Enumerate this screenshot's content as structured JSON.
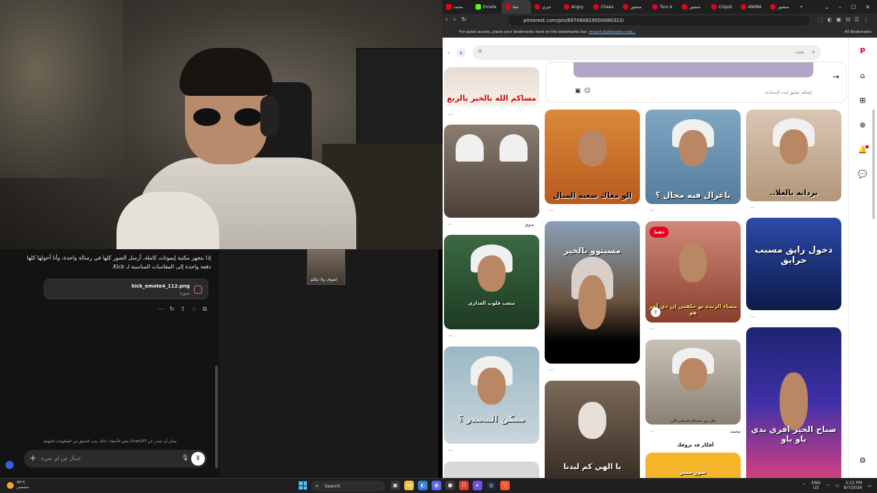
{
  "browser": {
    "tabs": [
      {
        "label": "محمد",
        "icon": "youtube-icon"
      },
      {
        "label": "Emote",
        "icon": "kick-icon"
      },
      {
        "label": "عط",
        "icon": "pinterest-icon",
        "active": true
      },
      {
        "label": "جيري",
        "icon": "pinterest-icon"
      },
      {
        "label": "Angry",
        "icon": "pinterest-icon"
      },
      {
        "label": "Chees",
        "icon": "pinterest-icon"
      },
      {
        "label": "منشور",
        "icon": "pinterest-icon"
      },
      {
        "label": "Tom A",
        "icon": "pinterest-icon"
      },
      {
        "label": "منشور",
        "icon": "pinterest-icon"
      },
      {
        "label": "Chipot",
        "icon": "pinterest-icon"
      },
      {
        "label": "ANIMA",
        "icon": "pinterest-icon"
      },
      {
        "label": "منشور",
        "icon": "pinterest-icon"
      }
    ],
    "url": "pinterest.com/pin/897060819500080322/",
    "bookmarks_prompt": "For quick access, place your bookmarks here on the bookmarks bar.",
    "bookmarks_import": "Import bookmarks now...",
    "all_bookmarks": "All Bookmarks"
  },
  "pinterest": {
    "search_placeholder": "بحث",
    "avatar_letter": "ع",
    "comment_placeholder": "إضافة تعليق لبدء المحادثة",
    "save_label": "حفظ",
    "ideas_label": "أفكار قد تروقك",
    "pins": [
      {
        "caption": "مساكم الله بالخير يالربع",
        "under": ""
      },
      {
        "caption": "",
        "under": "بدوي"
      },
      {
        "caption": "الو معاك صعبة المنال",
        "under": ""
      },
      {
        "caption": "ياغزال فيه مجال ؟",
        "under": ""
      },
      {
        "caption": "بردانه يالغلا..",
        "under": ""
      },
      {
        "caption": "متعب قلوب العذارى",
        "under": ""
      },
      {
        "caption": "مسيتوو بالخير",
        "under": ""
      },
      {
        "caption": "مساء الزبدة تو حلفتي إن دي آخر هو",
        "under": ""
      },
      {
        "caption": "دخول رايق مسبب حرايق",
        "under": ""
      },
      {
        "caption": "ممكن المصدر ؟",
        "under": ""
      },
      {
        "caption": "",
        "under": "محمد"
      },
      {
        "caption": "صباح الخير افري بدي ياو ياو",
        "under": ""
      },
      {
        "caption": "يا الهي كم لبدنا",
        "under": ""
      },
      {
        "caption": "صور مميز",
        "under": ""
      }
    ],
    "pin_sub_small": "هل من مشتاق لشتائي الي"
  },
  "chat": {
    "message": "إذا بتجهز مكتبة إيموتات كاملة، أرسل الصور كلها في رسالة واحدة، وأنا أحولها كلها دفعة واحدة إلى المقاسات المناسبة لـ Kick.",
    "attachment_name": "kick_emote4_112.png",
    "attachment_type": "صورة",
    "disclaimer": "يمكن أن تصدر عن ChatGPT بعض الأخطاء. لذلك يجب التحقق من المعلومات المهمة.",
    "input_placeholder": "اسأل عن أي شيء"
  },
  "thumb_caption": "اشوف ولا نتكلم",
  "taskbar": {
    "temp": "40°C",
    "weather": "مشمس",
    "search": "Search",
    "lang_top": "ENG",
    "lang_bottom": "US",
    "time": "5:12 PM",
    "date": "8/7/2026"
  },
  "colors": {
    "pinterest_red": "#e60023",
    "kick_green": "#53fc18",
    "windows_blue": "#4cc2ff"
  }
}
